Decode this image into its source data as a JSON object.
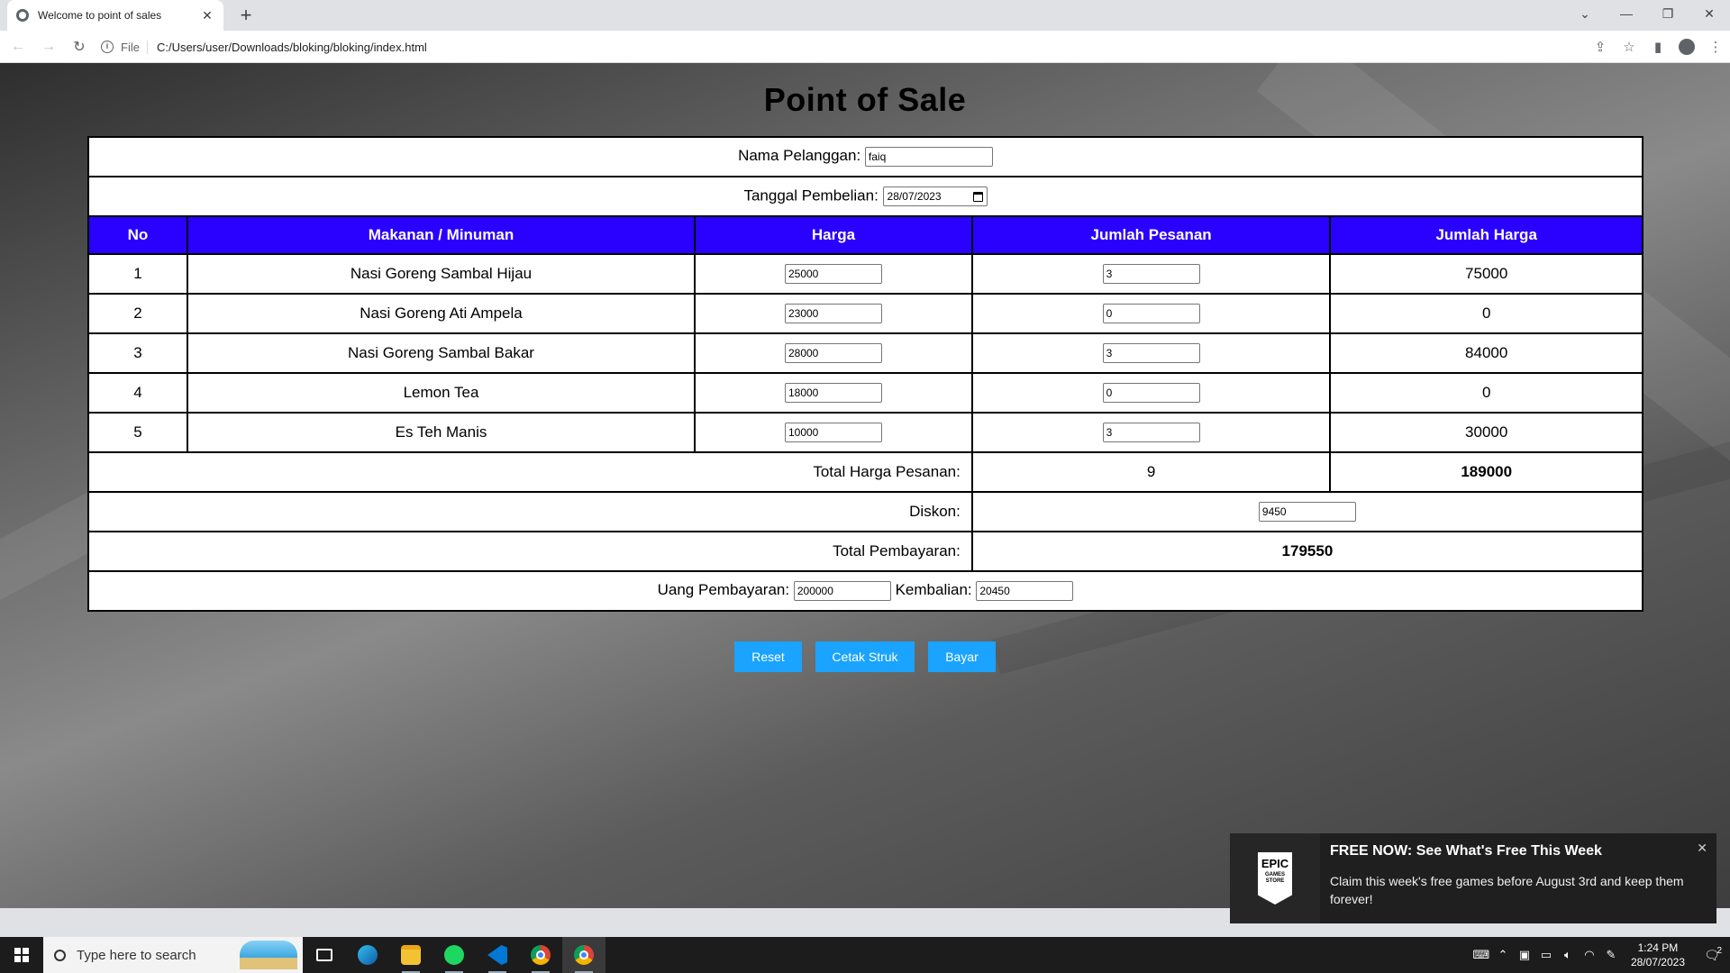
{
  "browser": {
    "tab_title": "Welcome to point of sales",
    "tab_close": "✕",
    "new_tab": "+",
    "scheme": "File",
    "url": "C:/Users/user/Downloads/bloking/bloking/index.html"
  },
  "page": {
    "title": "Point of Sale",
    "customer_label": "Nama Pelanggan:",
    "customer_value": "faiq",
    "date_label": "Tanggal Pembelian:",
    "date_value": "28/07/2023",
    "headers": [
      "No",
      "Makanan / Minuman",
      "Harga",
      "Jumlah Pesanan",
      "Jumlah Harga"
    ],
    "rows": [
      {
        "no": "1",
        "item": "Nasi Goreng Sambal Hijau",
        "price": "25000",
        "qty": "3",
        "subtotal": "75000"
      },
      {
        "no": "2",
        "item": "Nasi Goreng Ati Ampela",
        "price": "23000",
        "qty": "0",
        "subtotal": "0"
      },
      {
        "no": "3",
        "item": "Nasi Goreng Sambal Bakar",
        "price": "28000",
        "qty": "3",
        "subtotal": "84000"
      },
      {
        "no": "4",
        "item": "Lemon Tea",
        "price": "18000",
        "qty": "0",
        "subtotal": "0"
      },
      {
        "no": "5",
        "item": "Es Teh Manis",
        "price": "10000",
        "qty": "3",
        "subtotal": "30000"
      }
    ],
    "total_label": "Total Harga Pesanan:",
    "total_qty": "9",
    "total_price": "189000",
    "discount_label": "Diskon:",
    "discount_value": "9450",
    "payment_total_label": "Total Pembayaran:",
    "payment_total_value": "179550",
    "cash_label": "Uang Pembayaran:",
    "cash_value": "200000",
    "change_label": "Kembalian:",
    "change_value": "20450",
    "buttons": {
      "reset": "Reset",
      "print": "Cetak Struk",
      "pay": "Bayar"
    },
    "colors": {
      "header_bg": "#2a00ff",
      "button_bg": "#1aa3ff"
    }
  },
  "toast": {
    "logo_text": "EPIC",
    "logo_sub": "GAMES STORE",
    "title": "FREE NOW: See What's Free This Week",
    "text": "Claim this week's free games before August 3rd and keep them forever!",
    "close": "✕"
  },
  "taskbar": {
    "search_placeholder": "Type here to search",
    "time": "1:24 PM",
    "date": "28/07/2023",
    "notifications": "2"
  }
}
